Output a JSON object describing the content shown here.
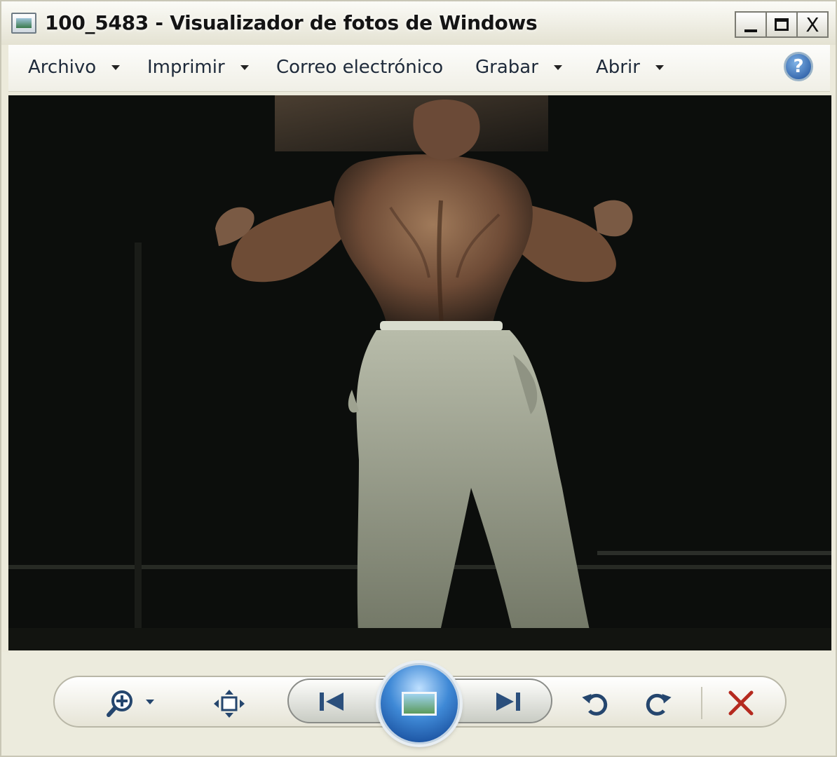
{
  "window": {
    "title": "100_5483 - Visualizador de fotos de Windows",
    "controls": {
      "minimize": "",
      "maximize": "",
      "close": "X"
    }
  },
  "menu": {
    "items": [
      {
        "label": "Archivo",
        "has_dropdown": true
      },
      {
        "label": "Imprimir",
        "has_dropdown": true
      },
      {
        "label": "Correo electrónico",
        "has_dropdown": false
      },
      {
        "label": "Grabar",
        "has_dropdown": true
      },
      {
        "label": "Abrir",
        "has_dropdown": true
      }
    ],
    "help_label": "?"
  },
  "photo": {
    "description_icon": "photo-image"
  },
  "toolbar": {
    "zoom_icon": "zoom-icon",
    "fit_icon": "actual-size-icon",
    "previous_icon": "previous-icon",
    "slideshow_icon": "slideshow-icon",
    "next_icon": "next-icon",
    "rotate_ccw_icon": "rotate-counterclockwise-icon",
    "rotate_cw_icon": "rotate-clockwise-icon",
    "delete_icon": "delete-icon"
  },
  "colors": {
    "title_bar": "#e4e2d2",
    "accent_blue": "#1d4f9a",
    "delete_red": "#b52a1f",
    "photo_bg": "#0b0d0b"
  }
}
